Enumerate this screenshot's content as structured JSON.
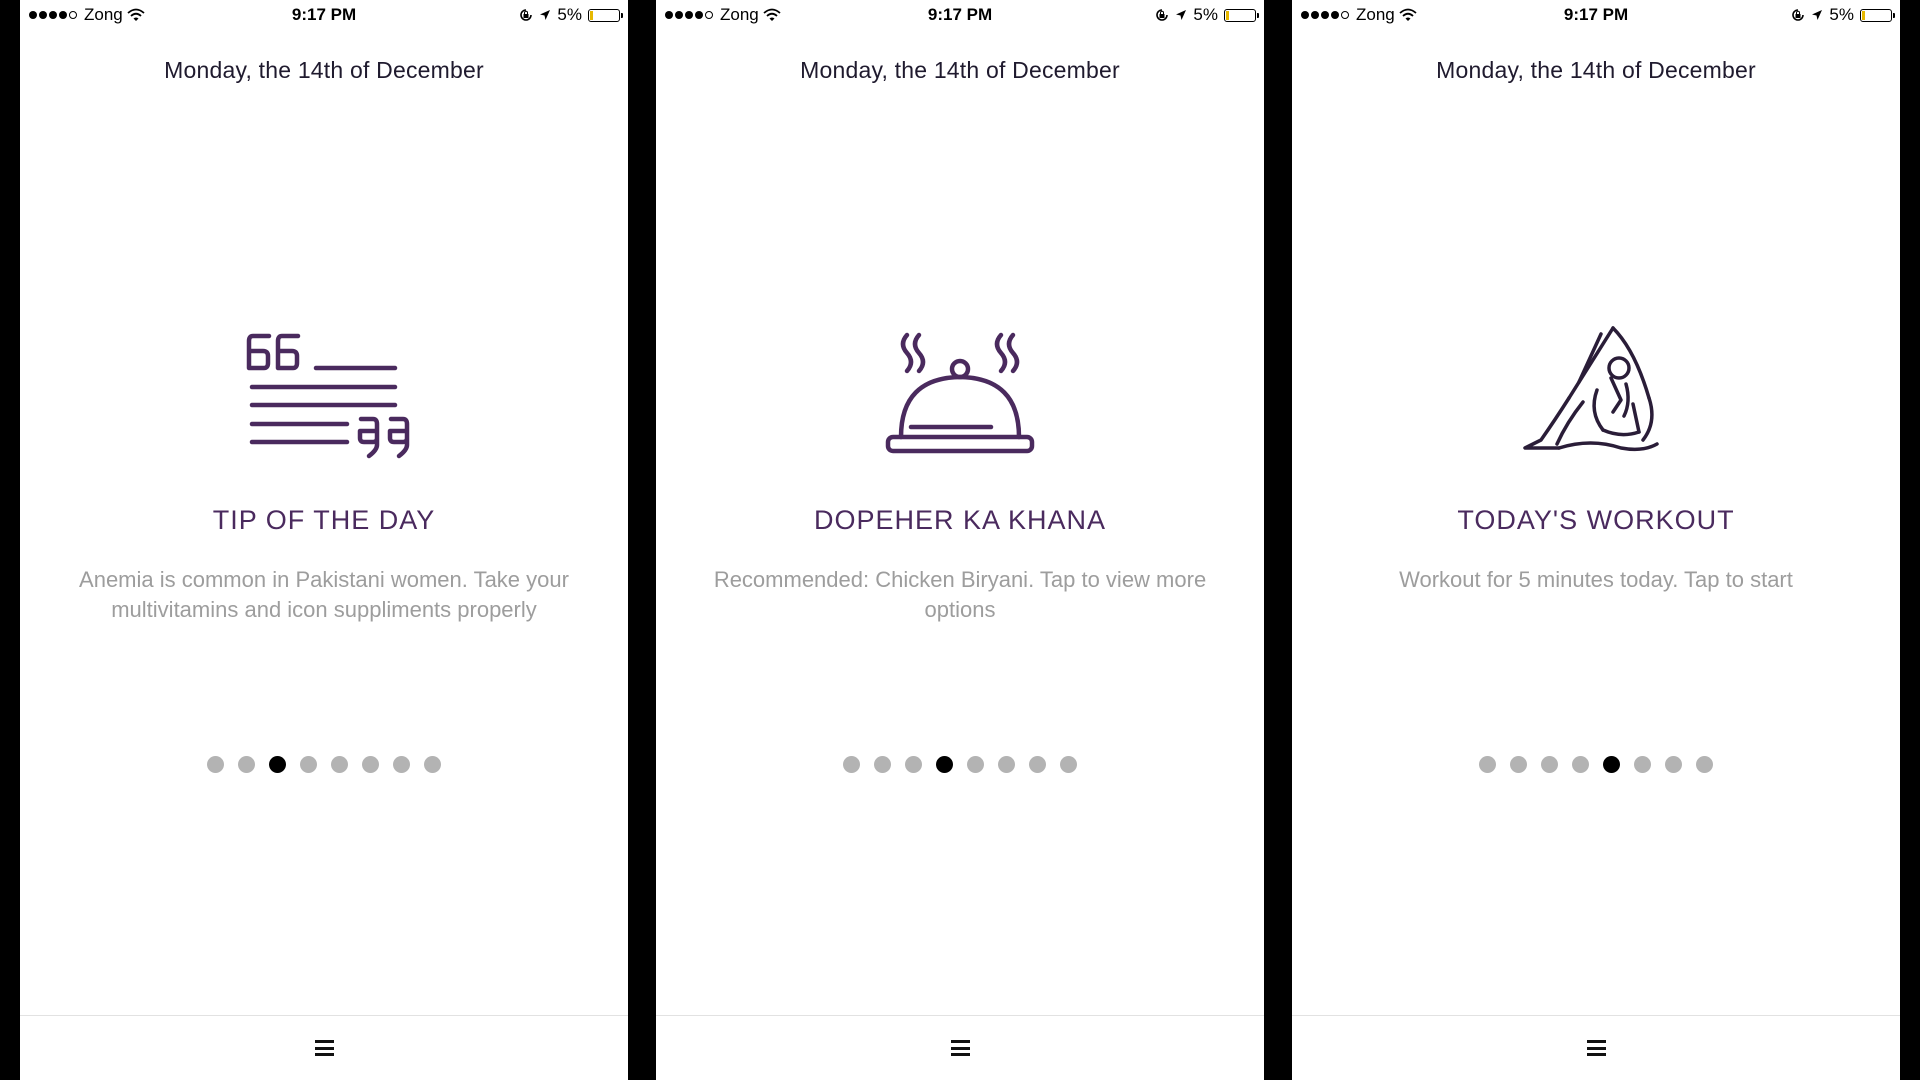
{
  "colors": {
    "accent": "#4a2a5e",
    "body_text": "#9d9d9d",
    "dot_inactive": "#b3b3b3",
    "dot_active": "#000000"
  },
  "screens": [
    {
      "status": {
        "carrier": "Zong",
        "time": "9:17 PM",
        "battery": "5%"
      },
      "date": "Monday, the 14th of December",
      "card": {
        "icon": "quote-icon",
        "heading": "TIP OF THE DAY",
        "body": "Anemia is common in Pakistani women. Take your multivitamins and icon suppliments properly"
      },
      "pager": {
        "count": 8,
        "active": 3
      },
      "bottom": {
        "icon": "hamburger-menu-icon"
      }
    },
    {
      "status": {
        "carrier": "Zong",
        "time": "9:17 PM",
        "battery": "5%"
      },
      "date": "Monday, the 14th of December",
      "card": {
        "icon": "cloche-food-icon",
        "heading": "DOPEHER KA KHANA",
        "body": "Recommended: Chicken Biryani. Tap to view more options"
      },
      "pager": {
        "count": 8,
        "active": 4
      },
      "bottom": {
        "icon": "hamburger-menu-icon"
      }
    },
    {
      "status": {
        "carrier": "Zong",
        "time": "9:17 PM",
        "battery": "5%"
      },
      "date": "Monday, the 14th of December",
      "card": {
        "icon": "yoga-pose-icon",
        "heading": "TODAY'S WORKOUT",
        "body": "Workout for 5 minutes today. Tap to start"
      },
      "pager": {
        "count": 8,
        "active": 5
      },
      "bottom": {
        "icon": "hamburger-menu-icon"
      }
    }
  ]
}
